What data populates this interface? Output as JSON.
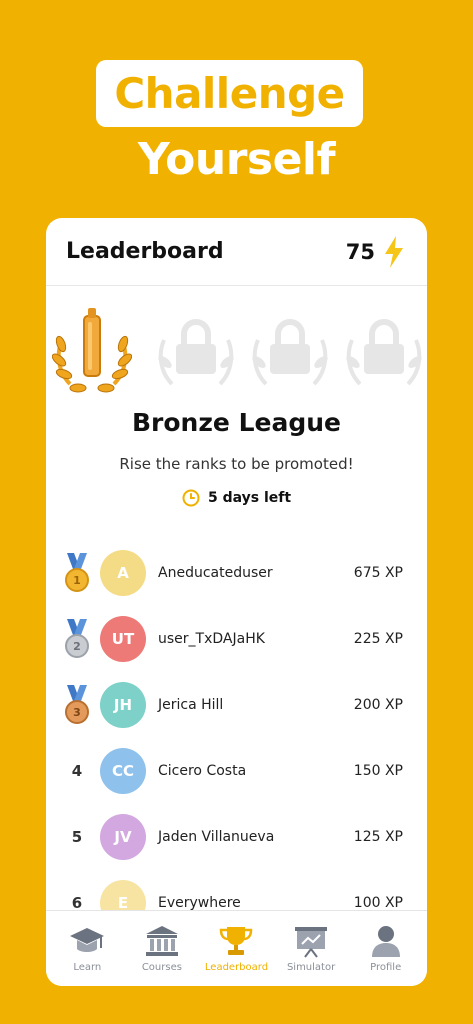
{
  "headline": {
    "line1": "Challenge",
    "line2": "Yourself"
  },
  "header": {
    "title": "Leaderboard",
    "xp_total": "75",
    "xp_icon": "lightning-bolt-icon"
  },
  "league": {
    "name": "Bronze League",
    "subtitle": "Rise the ranks to be promoted!",
    "time_left": "5 days left",
    "badges": [
      "bronze-trophy-badge",
      "locked-badge",
      "locked-badge",
      "locked-badge"
    ]
  },
  "ranking": [
    {
      "rank": "1",
      "medal": "gold-medal-icon",
      "initials": "A",
      "name": "Aneducateduser",
      "xp": "675 XP",
      "color": "#F4DB85"
    },
    {
      "rank": "2",
      "medal": "silver-medal-icon",
      "initials": "UT",
      "name": "user_TxDAJaHK",
      "xp": "225 XP",
      "color": "#EE7A77"
    },
    {
      "rank": "3",
      "medal": "bronze-medal-icon",
      "initials": "JH",
      "name": "Jerica Hill",
      "xp": "200 XP",
      "color": "#7DD1C8"
    },
    {
      "rank": "4",
      "medal": "",
      "initials": "CC",
      "name": "Cicero Costa",
      "xp": "150 XP",
      "color": "#8EC1EC"
    },
    {
      "rank": "5",
      "medal": "",
      "initials": "JV",
      "name": "Jaden Villanueva",
      "xp": "125 XP",
      "color": "#D3A7E0"
    },
    {
      "rank": "6",
      "medal": "",
      "initials": "E",
      "name": "Everywhere",
      "xp": "100 XP",
      "color": "#F7E4A2"
    }
  ],
  "tabs": [
    {
      "label": "Learn",
      "icon": "graduation-cap-icon"
    },
    {
      "label": "Courses",
      "icon": "bank-icon"
    },
    {
      "label": "Leaderboard",
      "icon": "trophy-icon",
      "active": true
    },
    {
      "label": "Simulator",
      "icon": "presentation-chart-icon"
    },
    {
      "label": "Profile",
      "icon": "person-icon"
    }
  ],
  "colors": {
    "brand": "#F0B100",
    "locked": "#E6E6E6"
  }
}
